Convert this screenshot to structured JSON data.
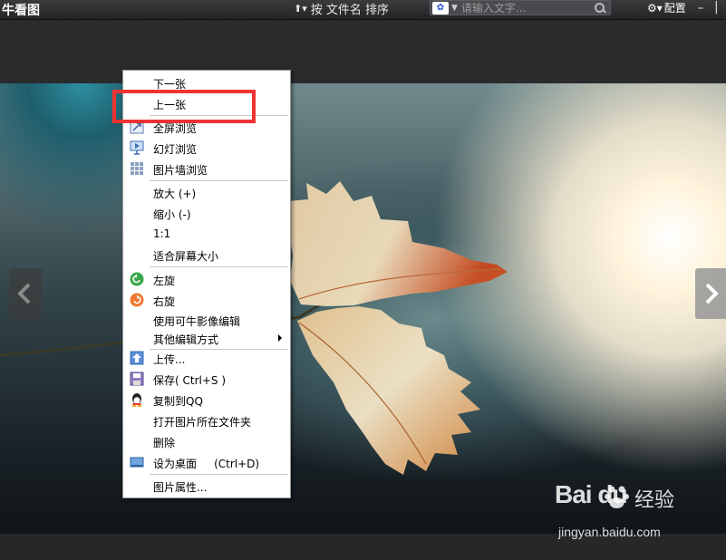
{
  "app": {
    "title": "牛看图",
    "sort_label": "按 文件名 排序",
    "search_placeholder": "请输入文字...",
    "config_label": "配置",
    "minimize": "–",
    "close": "|"
  },
  "menu": {
    "items": [
      {
        "label": "下一张",
        "icon": ""
      },
      {
        "label": "上一张",
        "icon": ""
      },
      {
        "label": "全屏浏览",
        "icon": "fullscreen-icon"
      },
      {
        "label": "幻灯浏览",
        "icon": "slideshow-icon"
      },
      {
        "label": "图片墙浏览",
        "icon": "picture-wall-icon"
      },
      {
        "label": "放大 (+)",
        "icon": ""
      },
      {
        "label": "缩小 (-)",
        "icon": ""
      },
      {
        "label": "1:1",
        "icon": ""
      },
      {
        "label": "适合屏幕大小",
        "icon": ""
      },
      {
        "label": "左旋",
        "icon": "rotate-left-icon"
      },
      {
        "label": "右旋",
        "icon": "rotate-right-icon"
      },
      {
        "label": "使用可牛影像编辑",
        "icon": ""
      },
      {
        "label": "其他编辑方式",
        "icon": "",
        "submenu": true
      },
      {
        "label": "上传...",
        "icon": "upload-icon"
      },
      {
        "label": "保存( Ctrl+S )",
        "icon": "save-icon"
      },
      {
        "label": "复制到QQ",
        "icon": "qq-icon"
      },
      {
        "label": "打开图片所在文件夹",
        "icon": ""
      },
      {
        "label": "删除",
        "icon": ""
      },
      {
        "label": "设为桌面     (Ctrl+D)",
        "icon": "desktop-icon"
      },
      {
        "label": "图片属性...",
        "icon": ""
      }
    ]
  },
  "watermark": {
    "logo": "Bai  du",
    "cn": "经验",
    "url": "jingyan.baidu.com"
  }
}
